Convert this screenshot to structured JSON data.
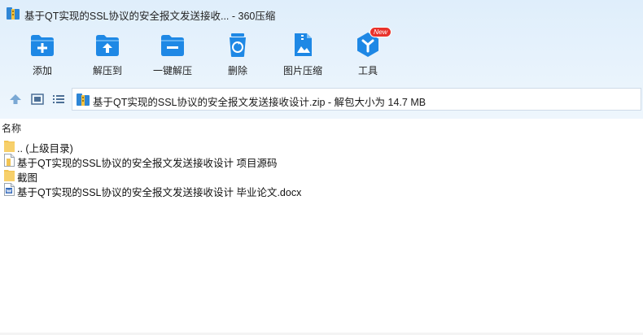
{
  "window": {
    "title": "基于QT实现的SSL协议的安全报文发送接收... - 360压缩"
  },
  "toolbar": {
    "buttons": [
      {
        "label": "添加",
        "icon": "add-folder-icon"
      },
      {
        "label": "解压到",
        "icon": "extract-to-icon"
      },
      {
        "label": "一键解压",
        "icon": "one-click-extract-icon"
      },
      {
        "label": "删除",
        "icon": "delete-icon"
      },
      {
        "label": "图片压缩",
        "icon": "image-compress-icon"
      },
      {
        "label": "工具",
        "icon": "tools-icon",
        "badge": "New"
      }
    ]
  },
  "address": {
    "path": "基于QT实现的SSL协议的安全报文发送接收设计.zip - 解包大小为 14.7 MB"
  },
  "list": {
    "column_name": "名称",
    "rows": [
      {
        "name": ".. (上级目录)",
        "type": "folder"
      },
      {
        "name": "基于QT实现的SSL协议的安全报文发送接收设计 项目源码",
        "type": "file"
      },
      {
        "name": "截图",
        "type": "folder"
      },
      {
        "name": "基于QT实现的SSL协议的安全报文发送接收设计 毕业论文.docx",
        "type": "docx"
      }
    ]
  },
  "colors": {
    "accent_blue": "#1e88e5",
    "toolbar_bg": "#e4f0fb",
    "badge_red": "#e8322b"
  }
}
